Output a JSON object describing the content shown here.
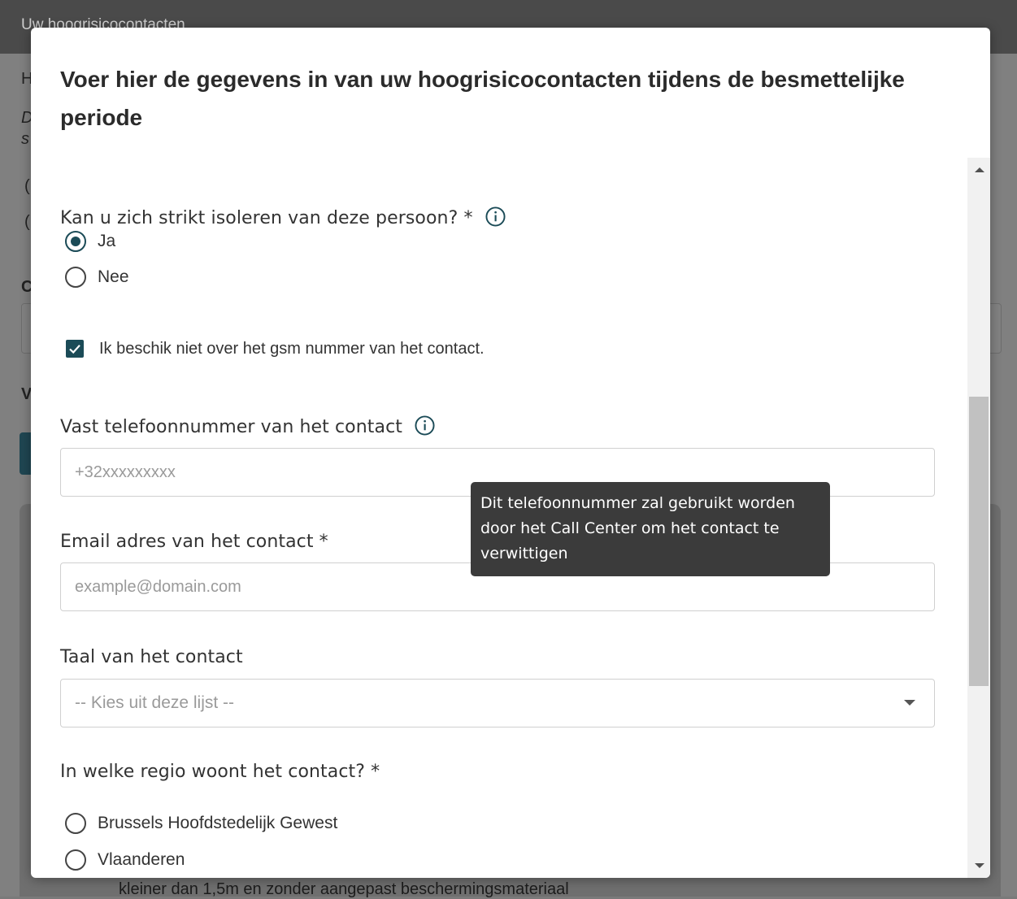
{
  "background": {
    "header_title": "Uw hoogrisicocontacten",
    "fragments": [
      "H",
      "D",
      "s",
      "(",
      "(",
      "C",
      "V"
    ],
    "bottom_text": "kleiner dan 1,5m en zonder aangepast beschermingsmateriaal"
  },
  "modal": {
    "title": "Voer hier de gegevens in van uw hoogrisicocontacten tijdens de besmettelijke periode"
  },
  "isolation": {
    "label": "Kan u zich strikt isoleren van deze persoon? *",
    "options": [
      {
        "label": "Ja",
        "checked": true
      },
      {
        "label": "Nee",
        "checked": false
      }
    ]
  },
  "no_gsm": {
    "label": "Ik beschik niet over het gsm nummer van het contact.",
    "checked": true
  },
  "landline": {
    "label": "Vast telefoonnummer van het contact",
    "placeholder": "+32xxxxxxxxx",
    "tooltip": "Dit telefoonnummer zal gebruikt worden door het Call Center om het contact te verwittigen"
  },
  "email": {
    "label": "Email adres van het contact *",
    "placeholder": "example@domain.com"
  },
  "language": {
    "label": "Taal van het contact",
    "selected": "-- Kies uit deze lijst --"
  },
  "region": {
    "label": "In welke regio woont het contact? *",
    "options": [
      {
        "label": "Brussels Hoofdstedelijk Gewest",
        "checked": false
      },
      {
        "label": "Vlaanderen",
        "checked": false
      }
    ]
  },
  "colors": {
    "accent": "#1b4b57",
    "tooltip_bg": "#3b3b3b",
    "overlay": "#808080"
  },
  "icons": [
    "info-icon",
    "check-icon",
    "caret-down-icon",
    "scroll-up-icon",
    "scroll-down-icon"
  ]
}
